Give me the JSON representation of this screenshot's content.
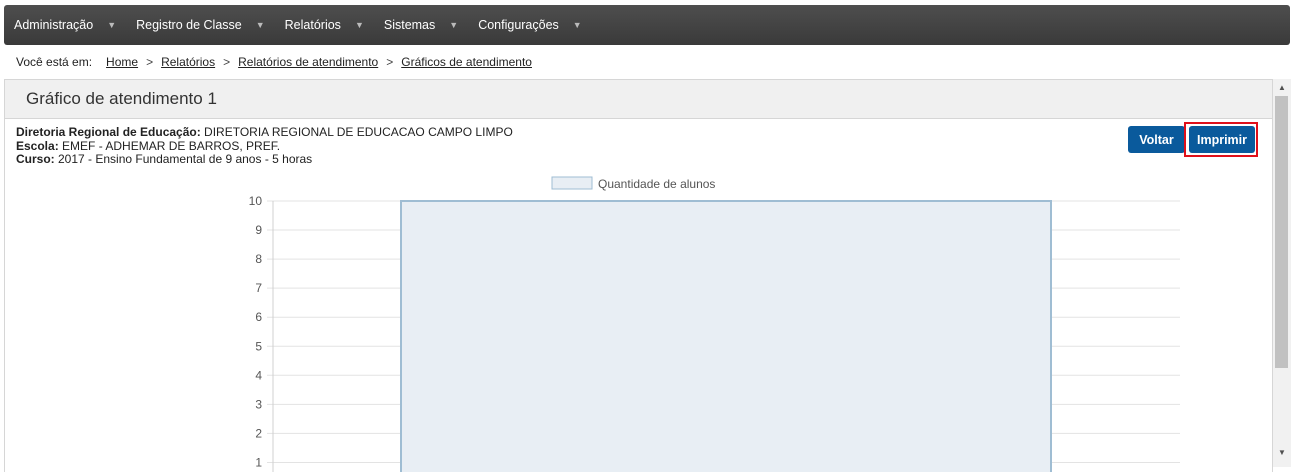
{
  "nav": {
    "items": [
      {
        "label": "Administração"
      },
      {
        "label": "Registro de Classe"
      },
      {
        "label": "Relatórios"
      },
      {
        "label": "Sistemas"
      },
      {
        "label": "Configurações"
      }
    ],
    "caret": "▼"
  },
  "breadcrumb": {
    "lead": "Você está em:",
    "items": [
      "Home",
      "Relatórios",
      "Relatórios de atendimento",
      "Gráficos de atendimento"
    ],
    "separator": ">"
  },
  "panel": {
    "title": "Gráfico de atendimento 1"
  },
  "info": {
    "dre_label": "Diretoria Regional de Educação:",
    "dre_value": " DIRETORIA REGIONAL DE EDUCACAO CAMPO LIMPO",
    "escola_label": "Escola:",
    "escola_value": " EMEF - ADHEMAR DE BARROS, PREF.",
    "curso_label": "Curso:",
    "curso_value": " 2017 - Ensino Fundamental de 9 anos - 5 horas"
  },
  "buttons": {
    "voltar": "Voltar",
    "imprimir": "Imprimir"
  },
  "chart_data": {
    "type": "bar",
    "categories": [
      ""
    ],
    "series": [
      {
        "name": "Quantidade de alunos",
        "values": [
          10
        ]
      }
    ],
    "yticks": [
      "10",
      "9",
      "8",
      "7",
      "6",
      "5",
      "4",
      "3",
      "2",
      "1"
    ],
    "ylim": [
      0,
      10
    ],
    "grid": true,
    "legend_position": "top",
    "colors": {
      "bar_fill": "#e8eef4",
      "bar_stroke": "#9fbdd3",
      "grid": "#e3e3e3"
    }
  },
  "scrollbar": {
    "up": "▲",
    "down": "▼"
  }
}
